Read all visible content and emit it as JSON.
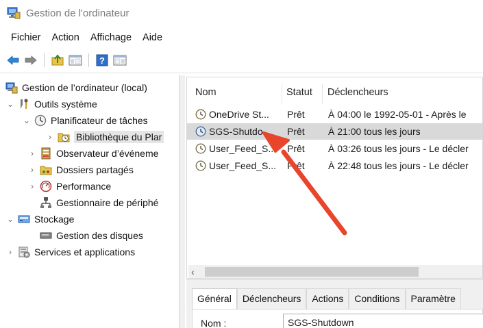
{
  "window": {
    "title": "Gestion de l'ordinateur"
  },
  "menu": [
    "Fichier",
    "Action",
    "Affichage",
    "Aide"
  ],
  "toolbar": {
    "buttons": [
      "back-icon",
      "forward-icon",
      "up-folder-icon",
      "show-hide-tree-icon",
      "help-icon",
      "action-pane-icon"
    ]
  },
  "tree": {
    "root": "Gestion de l’ordinateur (local)",
    "outils": "Outils système",
    "planificateur": "Planificateur de tâches",
    "bibliotheque": "Bibliothèque du Plar",
    "observateur": "Observateur d’événeme",
    "dossiers": "Dossiers partagés",
    "performance": "Performance",
    "gestionnaire": "Gestionnaire de périphé",
    "stockage": "Stockage",
    "disques": "Gestion des disques",
    "services": "Services et applications"
  },
  "columns": {
    "nom": "Nom",
    "statut": "Statut",
    "declencheurs": "Déclencheurs"
  },
  "tasks": [
    {
      "name": "OneDrive St...",
      "status": "Prêt",
      "trigger": "À 04:00 le 1992-05-01 - Après le"
    },
    {
      "name": "SGS-Shutdo...",
      "status": "Prêt",
      "trigger": "À 21:00 tous les jours"
    },
    {
      "name": "User_Feed_S...",
      "status": "Prêt",
      "trigger": "À 03:26 tous les jours - Le décler"
    },
    {
      "name": "User_Feed_S...",
      "status": "Prêt",
      "trigger": "À 22:48 tous les jours - Le décler"
    }
  ],
  "detail": {
    "tabs": [
      "Général",
      "Déclencheurs",
      "Actions",
      "Conditions",
      "Paramètre"
    ],
    "name_label": "Nom :",
    "name_value": "SGS-Shutdown"
  },
  "colors": {
    "arrow": "#e8452c",
    "selection": "#d9d9d9",
    "accent": "#1e78d4"
  }
}
